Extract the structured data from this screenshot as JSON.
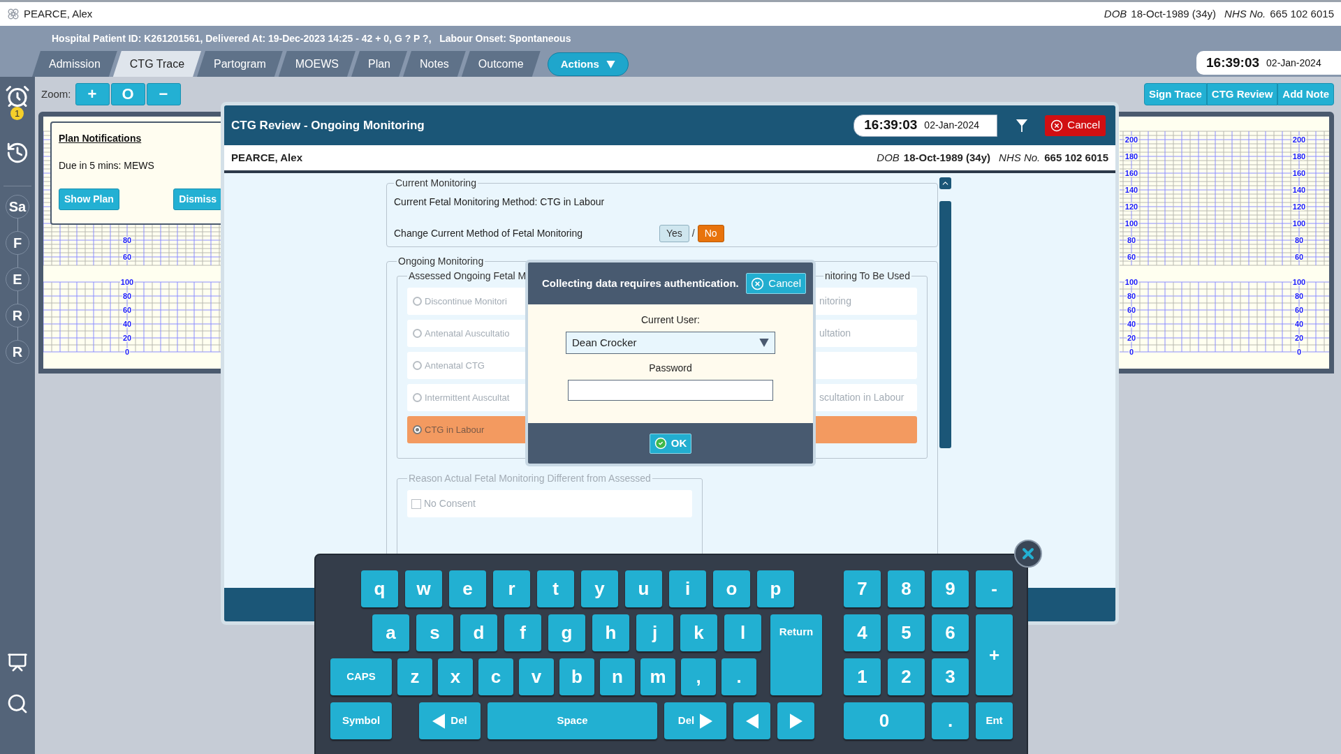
{
  "patient_header": {
    "name": "PEARCE, Alex",
    "dob_label": "DOB",
    "dob": "18-Oct-1989 (34y)",
    "nhs_label": "NHS No.",
    "nhs": "665 102 6015"
  },
  "patient_info": "Hospital Patient ID: K261201561, Delivered At: 19-Dec-2023 14:25 - 42 + 0, G ? P ?,   Labour Onset: Spontaneous",
  "tabs": [
    {
      "label": "Admission",
      "selected": false
    },
    {
      "label": "CTG Trace",
      "selected": true
    },
    {
      "label": "Partogram",
      "selected": false
    },
    {
      "label": "MOEWS",
      "selected": false
    },
    {
      "label": "Plan",
      "selected": false
    },
    {
      "label": "Notes",
      "selected": false
    },
    {
      "label": "Outcome",
      "selected": false
    }
  ],
  "actions_button": "Actions",
  "clock": {
    "time": "16:39:03",
    "date": "02-Jan-2024"
  },
  "toolbar": {
    "zoom_label": "Zoom:",
    "zoom_buttons": [
      "+",
      "O",
      "−"
    ],
    "buttons": [
      "Sign Trace",
      "CTG Review",
      "Add Note"
    ]
  },
  "sidebar": {
    "alarm_badge": "1",
    "steps": [
      "Sa",
      "F",
      "E",
      "R",
      "R"
    ]
  },
  "plan_notification": {
    "title": "Plan Notifications",
    "message": "Due in 5 mins: MEWS",
    "buttons": [
      "Show Plan",
      "Dismiss"
    ]
  },
  "trace_scales": {
    "left": [
      {
        "upper": [
          "80",
          "60"
        ],
        "lower": [
          "100",
          "80",
          "60",
          "40",
          "20",
          "0"
        ]
      }
    ],
    "right": [
      {
        "upper": [
          "200",
          "180",
          "160",
          "140",
          "120",
          "100",
          "80",
          "60"
        ],
        "lower": [
          "100",
          "80",
          "60",
          "40",
          "20",
          "0"
        ]
      },
      {
        "upper": [
          "200",
          "180",
          "160",
          "140",
          "120",
          "100",
          "80",
          "60"
        ],
        "lower": [
          "100",
          "80",
          "60",
          "40",
          "20",
          "0"
        ]
      }
    ]
  },
  "dialog": {
    "title": "CTG Review - Ongoing Monitoring",
    "time": "16:39:03",
    "date": "02-Jan-2024",
    "cancel": "Cancel",
    "patient": {
      "name": "PEARCE, Alex",
      "dob_label": "DOB",
      "dob": "18-Oct-1989 (34y)",
      "nhs_label": "NHS No.",
      "nhs": "665 102 6015"
    },
    "current_monitoring": {
      "legend": "Current Monitoring",
      "method": "Current Fetal Monitoring Method: CTG in Labour",
      "change_label": "Change Current Method of Fetal Monitoring",
      "separator": "/",
      "options": [
        {
          "label": "Yes",
          "selected": false
        },
        {
          "label": "No",
          "selected": true
        }
      ]
    },
    "ongoing_monitoring": {
      "legend": "Ongoing Monitoring",
      "assessed": {
        "legend": "Assessed Ongoing Fetal M",
        "disabled": true,
        "options": [
          {
            "label": "Discontinue Monitori",
            "selected": false
          },
          {
            "label": "Antenatal Auscultatio",
            "selected": false
          },
          {
            "label": "Antenatal CTG",
            "selected": false
          },
          {
            "label": "Intermittent Auscultat",
            "selected": false
          },
          {
            "label": "CTG in Labour",
            "selected": true
          }
        ]
      },
      "to_be_used": {
        "legend": "nitoring To Be Used",
        "disabled": true,
        "options": [
          {
            "label": "nitoring",
            "selected": false
          },
          {
            "label": "ultation",
            "selected": false
          },
          {
            "selected": false
          },
          {
            "label": "scultation in Labour",
            "selected": false
          },
          {
            "selected": true
          }
        ]
      }
    },
    "reason": {
      "legend": "Reason Actual Fetal Monitoring Different from Assessed",
      "disabled": true,
      "options": [
        {
          "label": "No Consent",
          "checked": false
        }
      ]
    }
  },
  "auth_popup": {
    "message": "Collecting data requires authentication.",
    "cancel": "Cancel",
    "user_label": "Current User:",
    "user_value": "Dean Crocker",
    "password_label": "Password",
    "ok": "OK"
  },
  "keyboard": {
    "letter_rows": [
      [
        "q",
        "w",
        "e",
        "r",
        "t",
        "y",
        "u",
        "i",
        "o",
        "p"
      ],
      [
        "a",
        "s",
        "d",
        "f",
        "g",
        "h",
        "j",
        "k",
        "l"
      ],
      [
        "z",
        "x",
        "c",
        "v",
        "b",
        "n",
        "m",
        ",",
        "."
      ]
    ],
    "return_key": "Return",
    "caps_key": "CAPS",
    "symbol_key": "Symbol",
    "delete_back_key": "Del",
    "space_key": "Space",
    "delete_forward_key": "Del",
    "enter_key": "Ent",
    "numpad": [
      "7",
      "8",
      "9",
      "-",
      "4",
      "5",
      "6",
      "+",
      "1",
      "2",
      "3",
      "0",
      "."
    ]
  }
}
